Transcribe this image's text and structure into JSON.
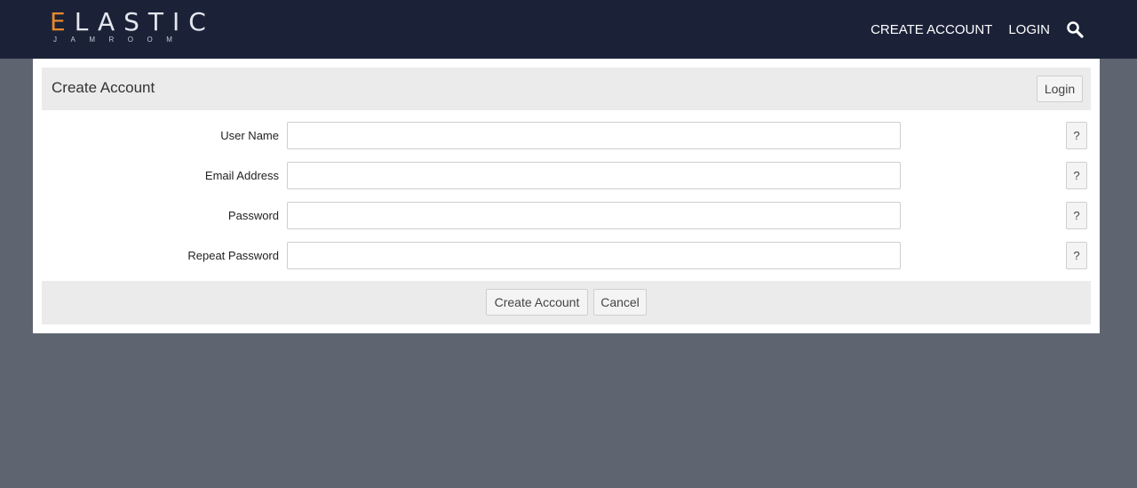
{
  "logo": {
    "first_letter": "E",
    "rest": "LASTIC",
    "sub": "JAMROOM"
  },
  "nav": {
    "create_account": "CREATE ACCOUNT",
    "login": "LOGIN",
    "search_icon": "search-icon"
  },
  "form": {
    "title": "Create Account",
    "login_button": "Login",
    "fields": [
      {
        "label": "User Name",
        "value": "",
        "help": "?"
      },
      {
        "label": "Email Address",
        "value": "",
        "help": "?"
      },
      {
        "label": "Password",
        "value": "",
        "help": "?"
      },
      {
        "label": "Repeat Password",
        "value": "",
        "help": "?"
      }
    ],
    "submit_label": "Create Account",
    "cancel_label": "Cancel"
  },
  "colors": {
    "topbar": "#1b2238",
    "page_background": "#5f6570",
    "logo_accent": "#e8892b",
    "panel_bar": "#ebebeb"
  }
}
